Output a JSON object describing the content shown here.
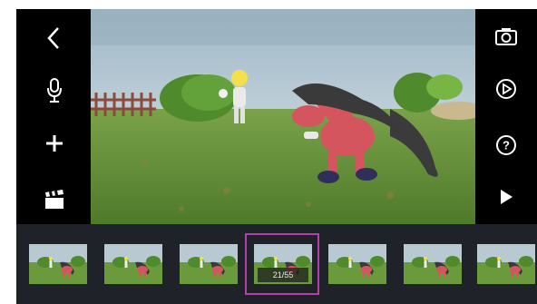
{
  "toolbar_left": [
    {
      "name": "back-icon"
    },
    {
      "name": "microphone-icon"
    },
    {
      "name": "add-icon"
    },
    {
      "name": "clapperboard-icon"
    }
  ],
  "toolbar_right": [
    {
      "name": "camera-icon"
    },
    {
      "name": "settings-icon"
    },
    {
      "name": "help-icon"
    },
    {
      "name": "play-icon"
    }
  ],
  "filmstrip": {
    "frame_counter": "21/55",
    "selected_frame_index": 3,
    "frame_count_visible": 7
  },
  "colors": {
    "background": "#000000",
    "filmstrip": "#1f2329",
    "selection": "#b440a8",
    "icon": "#ffffff"
  }
}
